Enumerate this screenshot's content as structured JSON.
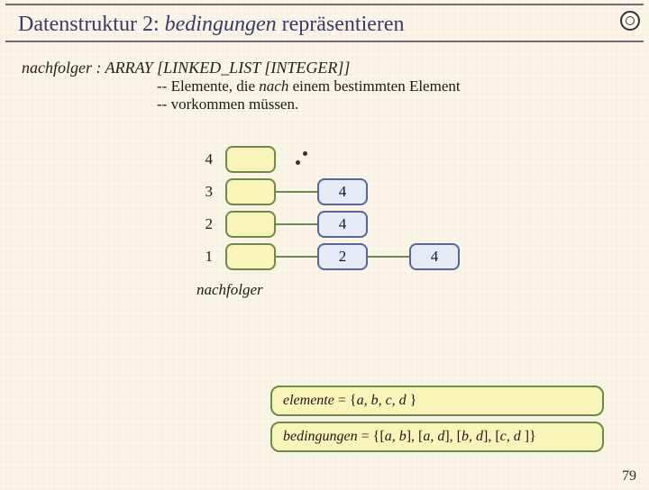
{
  "title": {
    "pre": "Datenstruktur 2: ",
    "ital": "bedingungen",
    "post": " repräsentieren"
  },
  "decl": {
    "name": "nachfolger",
    "type": " : ARRAY [LINKED_LIST [INTEGER]]"
  },
  "comment1": {
    "pre": "-- Elemente, die ",
    "ital": "nach",
    "post": " einem bestimmten Element"
  },
  "comment2": "-- vorkommen müssen.",
  "diagram": {
    "rows": [
      {
        "label": "4",
        "cells": []
      },
      {
        "label": "3",
        "cells": [
          "4"
        ]
      },
      {
        "label": "2",
        "cells": [
          "4"
        ]
      },
      {
        "label": "1",
        "cells": [
          "2",
          "4"
        ]
      }
    ],
    "caption": "nachfolger"
  },
  "eq1": {
    "lhs": "elemente",
    "rhs": " = {a, b, c, d }",
    "rhs_ital": "a, b, c, d"
  },
  "eq2": {
    "lhs": "bedingungen",
    "rhs": " = {[a, b], [a, d], [b, d], [c, d ]}",
    "rhs_ital": "a, b, a, d, b, d, c, d"
  },
  "page": "79"
}
